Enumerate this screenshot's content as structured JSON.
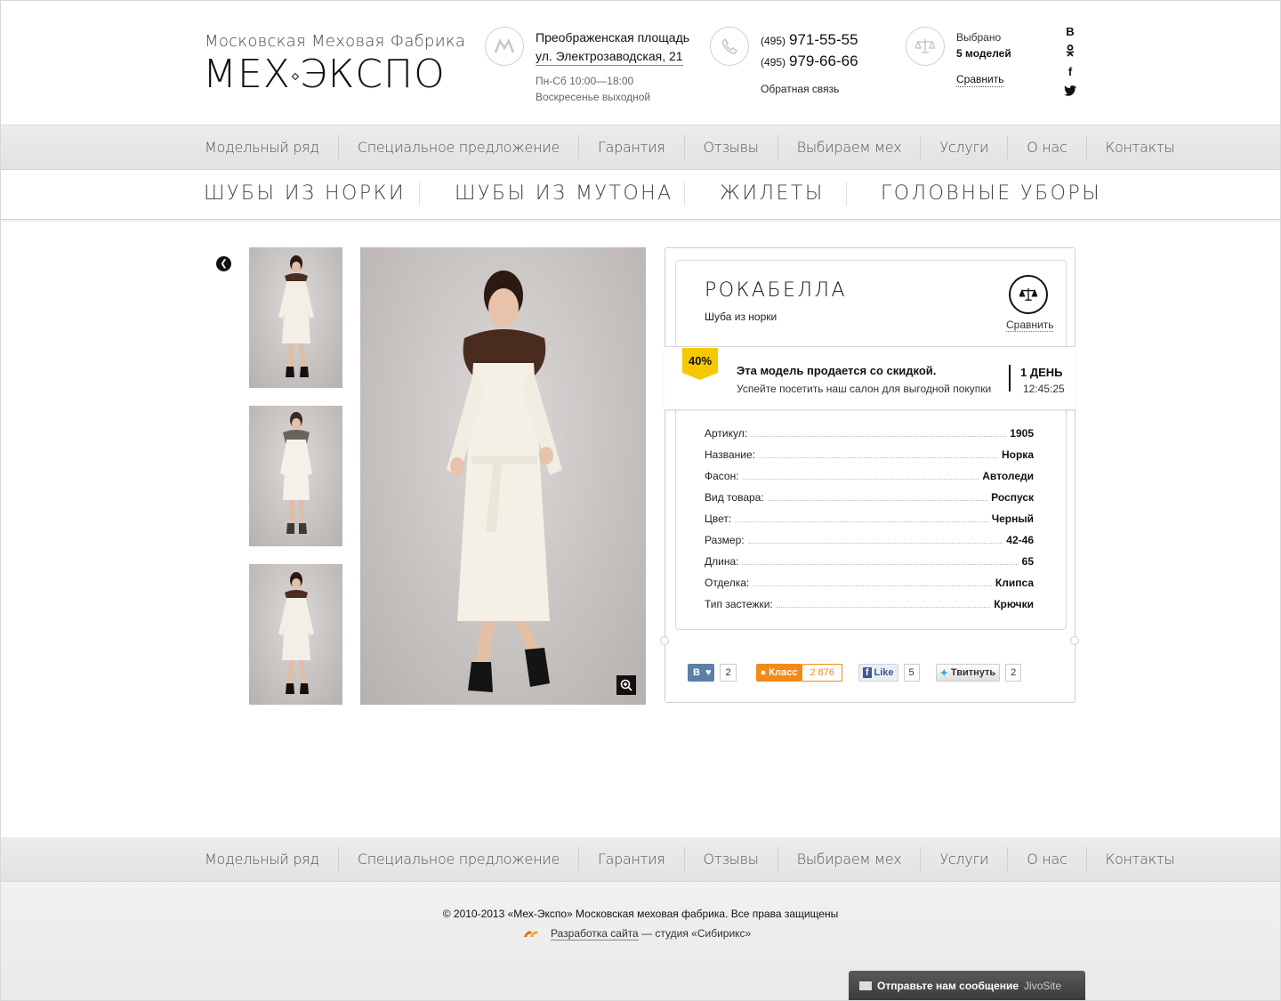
{
  "header": {
    "logo_sub": "Московская Меховая Фабрика",
    "logo_main_left": "МЕХ",
    "logo_main_right": "ЭКСПО",
    "address_line1": "Преображенская площадь",
    "address_line2": "ул. Электрозаводская, 21",
    "hours1": "Пн-Сб 10:00—18:00",
    "hours2": "Воскресенье выходной",
    "phone1_code": "(495)",
    "phone1": "971-55-55",
    "phone2_code": "(495)",
    "phone2": "979-66-66",
    "feedback": "Обратная связь",
    "selected_label": "Выбрано",
    "selected_count": "5 моделей",
    "compare_link": "Сравнить",
    "social": [
      "В",
      "ок",
      "f",
      "t"
    ]
  },
  "nav": [
    "Модельный ряд",
    "Специальное предложение",
    "Гарантия",
    "Отзывы",
    "Выбираем мех",
    "Услуги",
    "О нас",
    "Контакты"
  ],
  "categories": [
    "ШУБЫ ИЗ НОРКИ",
    "ШУБЫ ИЗ МУТОНА",
    "ЖИЛЕТЫ",
    "ГОЛОВНЫЕ УБОРЫ"
  ],
  "product": {
    "title": "РОКАБЕЛЛА",
    "subtitle": "Шуба из норки",
    "compare": "Сравнить",
    "sale_badge": "40%",
    "sale_title": "Эта модель продается со скидкой.",
    "sale_text": "Успейте посетить наш салон для выгодной покупки",
    "timer_days": "1 ДЕНЬ",
    "timer_time": "12:45:25",
    "specs": [
      {
        "k": "Артикул:",
        "v": "1905"
      },
      {
        "k": "Название:",
        "v": "Норка"
      },
      {
        "k": "Фасон:",
        "v": "Автоледи"
      },
      {
        "k": "Вид товара:",
        "v": "Роспуск"
      },
      {
        "k": "Цвет:",
        "v": "Черный"
      },
      {
        "k": "Размер:",
        "v": "42-46"
      },
      {
        "k": "Длина:",
        "v": "65"
      },
      {
        "k": "Отделка:",
        "v": "Клипса"
      },
      {
        "k": "Тип застежки:",
        "v": "Крючки"
      }
    ],
    "share": {
      "vk_label": "В",
      "vk_count": "2",
      "ok_label": "Класс",
      "ok_count": "2 876",
      "fb_label": "Like",
      "fb_count": "5",
      "tw_label": "Твитнуть",
      "tw_count": "2"
    }
  },
  "footer": {
    "nav": [
      "Модельный ряд",
      "Специальное предложение",
      "Гарантия",
      "Отзывы",
      "Выбираем мех",
      "Услуги",
      "О нас",
      "Контакты"
    ],
    "copyright": "© 2010-2013 «Мех-Экспо» Московская меховая фабрика. Все права защищены",
    "dev_link": "Разработка сайта",
    "dev_rest": " — студия «Сибирикс»",
    "jivo_text": "Отправьте нам сообщение",
    "jivo_brand": "JivoSite"
  },
  "colors": {
    "badge": "#f5c800",
    "ok_orange": "#f28a1a",
    "vk_blue": "#5b7fa6"
  }
}
